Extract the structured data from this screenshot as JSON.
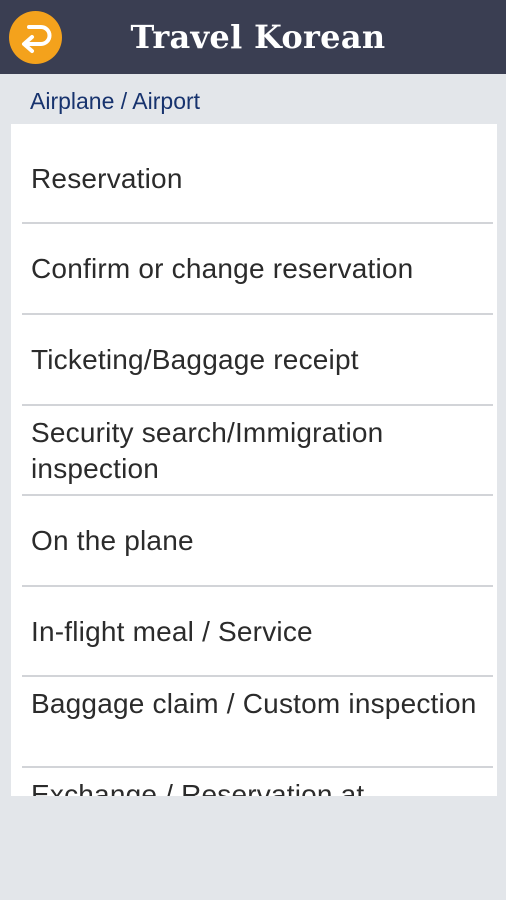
{
  "header": {
    "title": "Travel Korean",
    "back_icon": "back-arrow-icon",
    "background_color": "#3a3e52",
    "back_button_color": "#f4a21c"
  },
  "section": {
    "title": "Airplane / Airport"
  },
  "items": [
    {
      "label": "Reservation"
    },
    {
      "label": "Confirm or change reservation"
    },
    {
      "label": "Ticketing/Baggage receipt"
    },
    {
      "label": "Security search/Immigration inspection"
    },
    {
      "label": "On the plane"
    },
    {
      "label": "In-flight meal / Service"
    },
    {
      "label": "Baggage claim / Custom inspection"
    },
    {
      "label": "Exchange / Reservation at"
    }
  ]
}
